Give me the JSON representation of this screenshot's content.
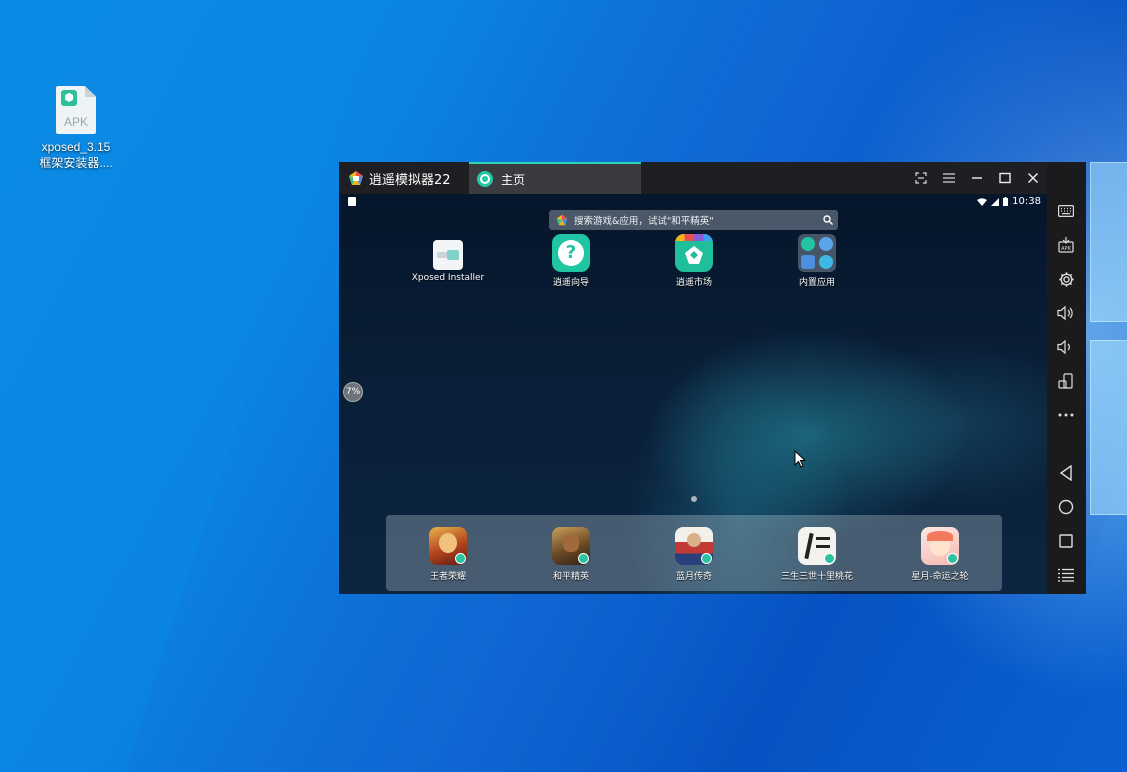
{
  "desktop": {
    "icons": [
      {
        "name": "apk-file",
        "type_label": "APK",
        "label": "xposed_3.15\n框架安装器...."
      }
    ]
  },
  "emulator": {
    "app_title": "逍遥模拟器22",
    "tab_label": "主页",
    "accent": "#2fd4b4",
    "status_bar": {
      "time": "10:38"
    },
    "search_placeholder": "搜索游戏&应用，试试\"和平精英\"",
    "home_apps": [
      {
        "label": "Xposed Installer"
      },
      {
        "label": "逍遥向导"
      },
      {
        "label": "逍遥市场"
      },
      {
        "label": "内置应用"
      }
    ],
    "side_badge": "7%",
    "dock_apps": [
      {
        "label": "王者荣耀"
      },
      {
        "label": "和平精英"
      },
      {
        "label": "蓝月传奇"
      },
      {
        "label": "三生三世十里桃花"
      },
      {
        "label": "星月-命运之轮"
      }
    ],
    "toolbar_icons": [
      "collapse-icon",
      "keyboard-icon",
      "apk-install-icon",
      "settings-icon",
      "volume-up-icon",
      "volume-down-icon",
      "rotate-icon",
      "more-icon",
      "back-icon",
      "home-icon",
      "recents-icon",
      "menu-icon"
    ]
  }
}
